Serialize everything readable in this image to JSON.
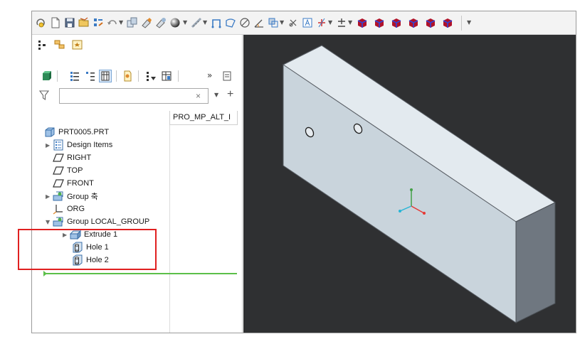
{
  "toolbar": {
    "icons": [
      "regenerate-icon",
      "new-icon",
      "save-icon",
      "open-icon",
      "model-tree-settings-icon",
      "undo-icon",
      "copy-icon",
      "paint-icon",
      "appearance-icon",
      "sphere-icon",
      "measure-icon",
      "datum-icon",
      "sketch-icon",
      "circle-icon",
      "angle-icon",
      "view-icon",
      "close-window-icon",
      "annotation-icon",
      "tolerance-icon",
      "plus-minus-icon",
      "view-cube-icon"
    ]
  },
  "panel": {
    "tabs": [
      "model-tree-tab",
      "layer-tree-tab",
      "favorites-tab"
    ],
    "filter": {
      "value": "",
      "placeholder": "",
      "clear": "×"
    },
    "column_header": "PRO_MP_ALT_I",
    "tree": [
      {
        "label": "PRT0005.PRT",
        "icon": "part-icon",
        "expander": ""
      },
      {
        "label": "Design Items",
        "icon": "design-items-icon",
        "expander": "▶"
      },
      {
        "label": "RIGHT",
        "icon": "datum-plane-icon",
        "expander": ""
      },
      {
        "label": "TOP",
        "icon": "datum-plane-icon",
        "expander": ""
      },
      {
        "label": "FRONT",
        "icon": "datum-plane-icon",
        "expander": ""
      },
      {
        "label": "Group 축",
        "icon": "group-icon",
        "expander": "▶"
      },
      {
        "label": "ORG",
        "icon": "coordinate-system-icon",
        "expander": ""
      },
      {
        "label": "Group LOCAL_GROUP",
        "icon": "group-icon",
        "expander": "▼"
      },
      {
        "label": "Extrude 1",
        "icon": "extrude-icon",
        "expander": "▶"
      },
      {
        "label": "Hole 1",
        "icon": "hole-icon",
        "expander": ""
      },
      {
        "label": "Hole 2",
        "icon": "hole-icon",
        "expander": ""
      }
    ]
  },
  "colors": {
    "viewport_bg": "#2f3032",
    "part_top": "#e3eaef",
    "part_front": "#c9d4dc",
    "part_side": "#6f7780",
    "insert_line": "#5cbf49",
    "highlight": "#e02020",
    "axis_x": "#e53935",
    "axis_y": "#43a047",
    "axis_z": "#26b5d6"
  }
}
